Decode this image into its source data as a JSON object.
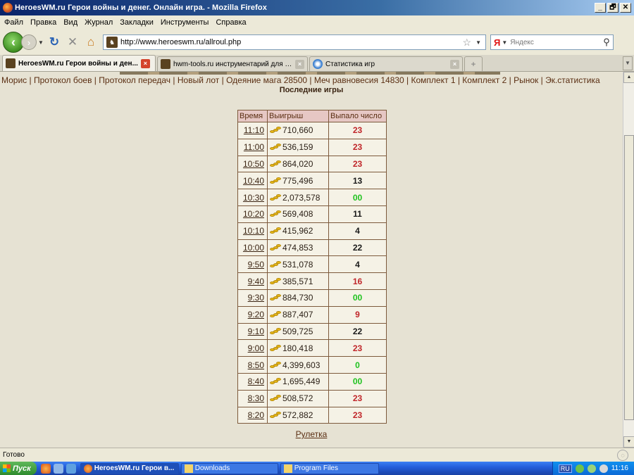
{
  "window": {
    "title": "HeroesWM.ru Герои войны и денег. Онлайн игра. - Mozilla Firefox",
    "buttons": {
      "minimize": "_",
      "maximize": "🗗",
      "close": "✕"
    }
  },
  "menu": [
    "Файл",
    "Правка",
    "Вид",
    "Журнал",
    "Закладки",
    "Инструменты",
    "Справка"
  ],
  "nav": {
    "url": "http://www.heroeswm.ru/allroul.php",
    "search_engine": "Я",
    "search_placeholder": "Яндекс"
  },
  "tabs": [
    {
      "label": "HeroesWM.ru Герои войны и ден...",
      "active": true
    },
    {
      "label": "hwm-tools.ru инструментарий для иг...",
      "active": false
    },
    {
      "label": "Статистика игр",
      "active": false
    }
  ],
  "page": {
    "top_links": [
      "Морис",
      "Протокол боев",
      "Протокол передач",
      "Новый лот",
      "Одеяние мага 28500",
      "Меч равновесия 14830",
      "Комплект 1",
      "Комплект 2",
      "Рынок",
      "Эк.статистика"
    ],
    "heading": "Последние игры",
    "table": {
      "headers": [
        "Время",
        "Выигрыш",
        "Выпало число"
      ],
      "rows": [
        {
          "time": "11:10",
          "win": "710,660",
          "number": "23",
          "color": "#c0262a"
        },
        {
          "time": "11:00",
          "win": "536,159",
          "number": "23",
          "color": "#c0262a"
        },
        {
          "time": "10:50",
          "win": "864,020",
          "number": "23",
          "color": "#c0262a"
        },
        {
          "time": "10:40",
          "win": "775,496",
          "number": "13",
          "color": "#1a1a1a"
        },
        {
          "time": "10:30",
          "win": "2,073,578",
          "number": "00",
          "color": "#1fc21f"
        },
        {
          "time": "10:20",
          "win": "569,408",
          "number": "11",
          "color": "#1a1a1a"
        },
        {
          "time": "10:10",
          "win": "415,962",
          "number": "4",
          "color": "#1a1a1a"
        },
        {
          "time": "10:00",
          "win": "474,853",
          "number": "22",
          "color": "#1a1a1a"
        },
        {
          "time": "9:50",
          "win": "531,078",
          "number": "4",
          "color": "#1a1a1a"
        },
        {
          "time": "9:40",
          "win": "385,571",
          "number": "16",
          "color": "#c0262a"
        },
        {
          "time": "9:30",
          "win": "884,730",
          "number": "00",
          "color": "#1fc21f"
        },
        {
          "time": "9:20",
          "win": "887,407",
          "number": "9",
          "color": "#c0262a"
        },
        {
          "time": "9:10",
          "win": "509,725",
          "number": "22",
          "color": "#1a1a1a"
        },
        {
          "time": "9:00",
          "win": "180,418",
          "number": "23",
          "color": "#c0262a"
        },
        {
          "time": "8:50",
          "win": "4,399,603",
          "number": "0",
          "color": "#1fc21f"
        },
        {
          "time": "8:40",
          "win": "1,695,449",
          "number": "00",
          "color": "#1fc21f"
        },
        {
          "time": "8:30",
          "win": "508,572",
          "number": "23",
          "color": "#c0262a"
        },
        {
          "time": "8:20",
          "win": "572,882",
          "number": "23",
          "color": "#c0262a"
        }
      ]
    },
    "roulette_link": "Рулетка"
  },
  "status": {
    "text": "Готово"
  },
  "taskbar": {
    "start": "Пуск",
    "tasks": [
      {
        "label": "HeroesWM.ru Герои в...",
        "active": true
      },
      {
        "label": "Downloads",
        "active": false
      },
      {
        "label": "Program Files",
        "active": false
      }
    ],
    "lang": "RU",
    "clock": "11:16"
  }
}
